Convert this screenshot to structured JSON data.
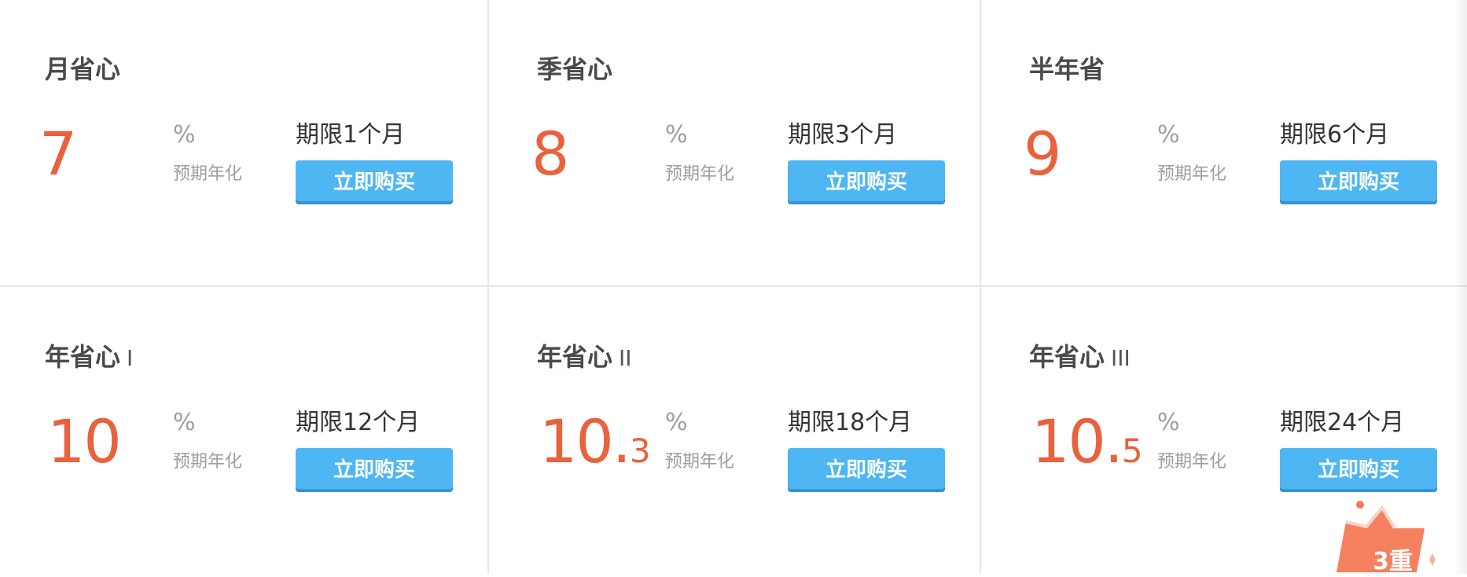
{
  "labels": {
    "percent": "%",
    "annualized": "预期年化",
    "buy": "立即购买"
  },
  "products": [
    {
      "name": "月省心",
      "suffix": "",
      "rate_int": "7",
      "rate_dec": "",
      "term": "期限1个月"
    },
    {
      "name": "季省心",
      "suffix": "",
      "rate_int": "8",
      "rate_dec": "",
      "term": "期限3个月"
    },
    {
      "name": "半年省",
      "suffix": "",
      "rate_int": "9",
      "rate_dec": "",
      "term": "期限6个月"
    },
    {
      "name": "年省心",
      "suffix": "I",
      "rate_int": "10",
      "rate_dec": "",
      "term": "期限12个月"
    },
    {
      "name": "年省心",
      "suffix": "II",
      "rate_int": "10.",
      "rate_dec": "3",
      "term": "期限18个月"
    },
    {
      "name": "年省心",
      "suffix": "III",
      "rate_int": "10.",
      "rate_dec": "5",
      "term": "期限24个月"
    }
  ],
  "badge": {
    "text": "3重"
  },
  "colors": {
    "accent": "#e9613d",
    "button": "#4db6f3",
    "divider": "#e6e6e6"
  }
}
